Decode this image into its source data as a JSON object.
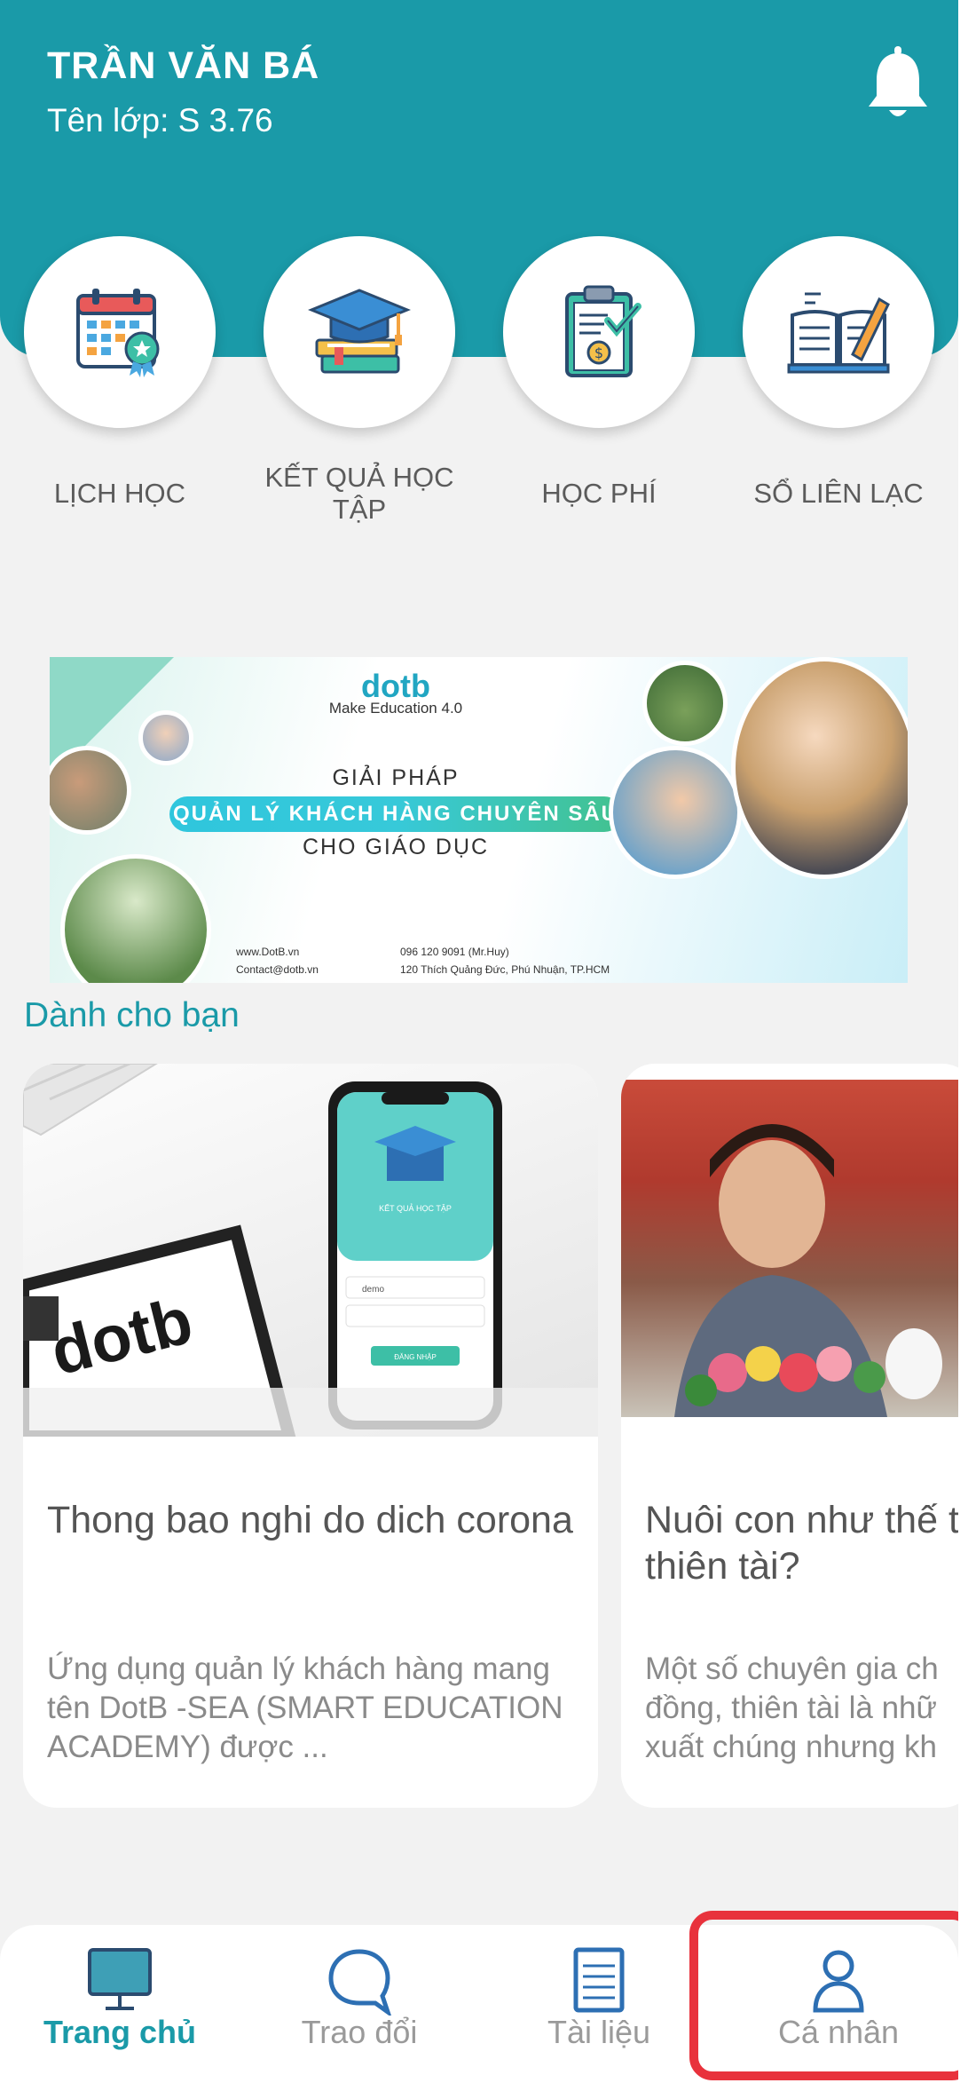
{
  "header": {
    "user_name": "TRẦN VĂN BÁ",
    "class_label": "Tên lớp: S 3.76",
    "bell_icon": "bell-icon",
    "bg_color": "#1a9aa8"
  },
  "quick_menu": [
    {
      "label": "LỊCH HỌC",
      "icon": "calendar-icon"
    },
    {
      "label": "KẾT QUẢ HỌC TẬP",
      "icon": "graduation-books-icon"
    },
    {
      "label": "HỌC PHÍ",
      "icon": "tuition-clipboard-icon"
    },
    {
      "label": "SỔ LIÊN LẠC",
      "icon": "open-book-pen-icon"
    }
  ],
  "banner": {
    "brand": "dotb",
    "tagline": "Make Education 4.0",
    "line1": "GIẢI PHÁP",
    "line2": "QUẢN LÝ KHÁCH HÀNG CHUYÊN SÂU",
    "line3": "CHO GIÁO DỤC",
    "website": "www.DotB.vn",
    "email": "Contact@dotb.vn",
    "phone": "096 120 9091 (Mr.Huy)",
    "address": "120 Thích Quảng Đức, Phú Nhuận, TP.HCM"
  },
  "section": {
    "title": "Dành cho bạn"
  },
  "articles": [
    {
      "title": "Thong bao nghi do dich corona",
      "description": "Ứng dụng quản lý khách hàng mang tên DotB -SEA (SMART EDUCATION ACADEMY) được ...",
      "image_logo": "dotb",
      "phone_screen_title": "KẾT QUẢ HỌC TẬP",
      "phone_field": "demo",
      "phone_button": "ĐĂNG NHẬP"
    },
    {
      "title": "Nuôi con như thế thành thiên tài?",
      "description": "Một số chuyên gia ch đồng, thiên tài là nhữ xuất chúng nhưng kh"
    }
  ],
  "bottom_nav": [
    {
      "label": "Trang chủ",
      "icon": "monitor-icon",
      "active": true
    },
    {
      "label": "Trao đổi",
      "icon": "chat-bubble-icon",
      "active": false
    },
    {
      "label": "Tài liệu",
      "icon": "document-icon",
      "active": false
    },
    {
      "label": "Cá nhân",
      "icon": "person-icon",
      "active": false
    }
  ],
  "colors": {
    "accent": "#1a9aa8",
    "highlight": "#e8323c"
  }
}
